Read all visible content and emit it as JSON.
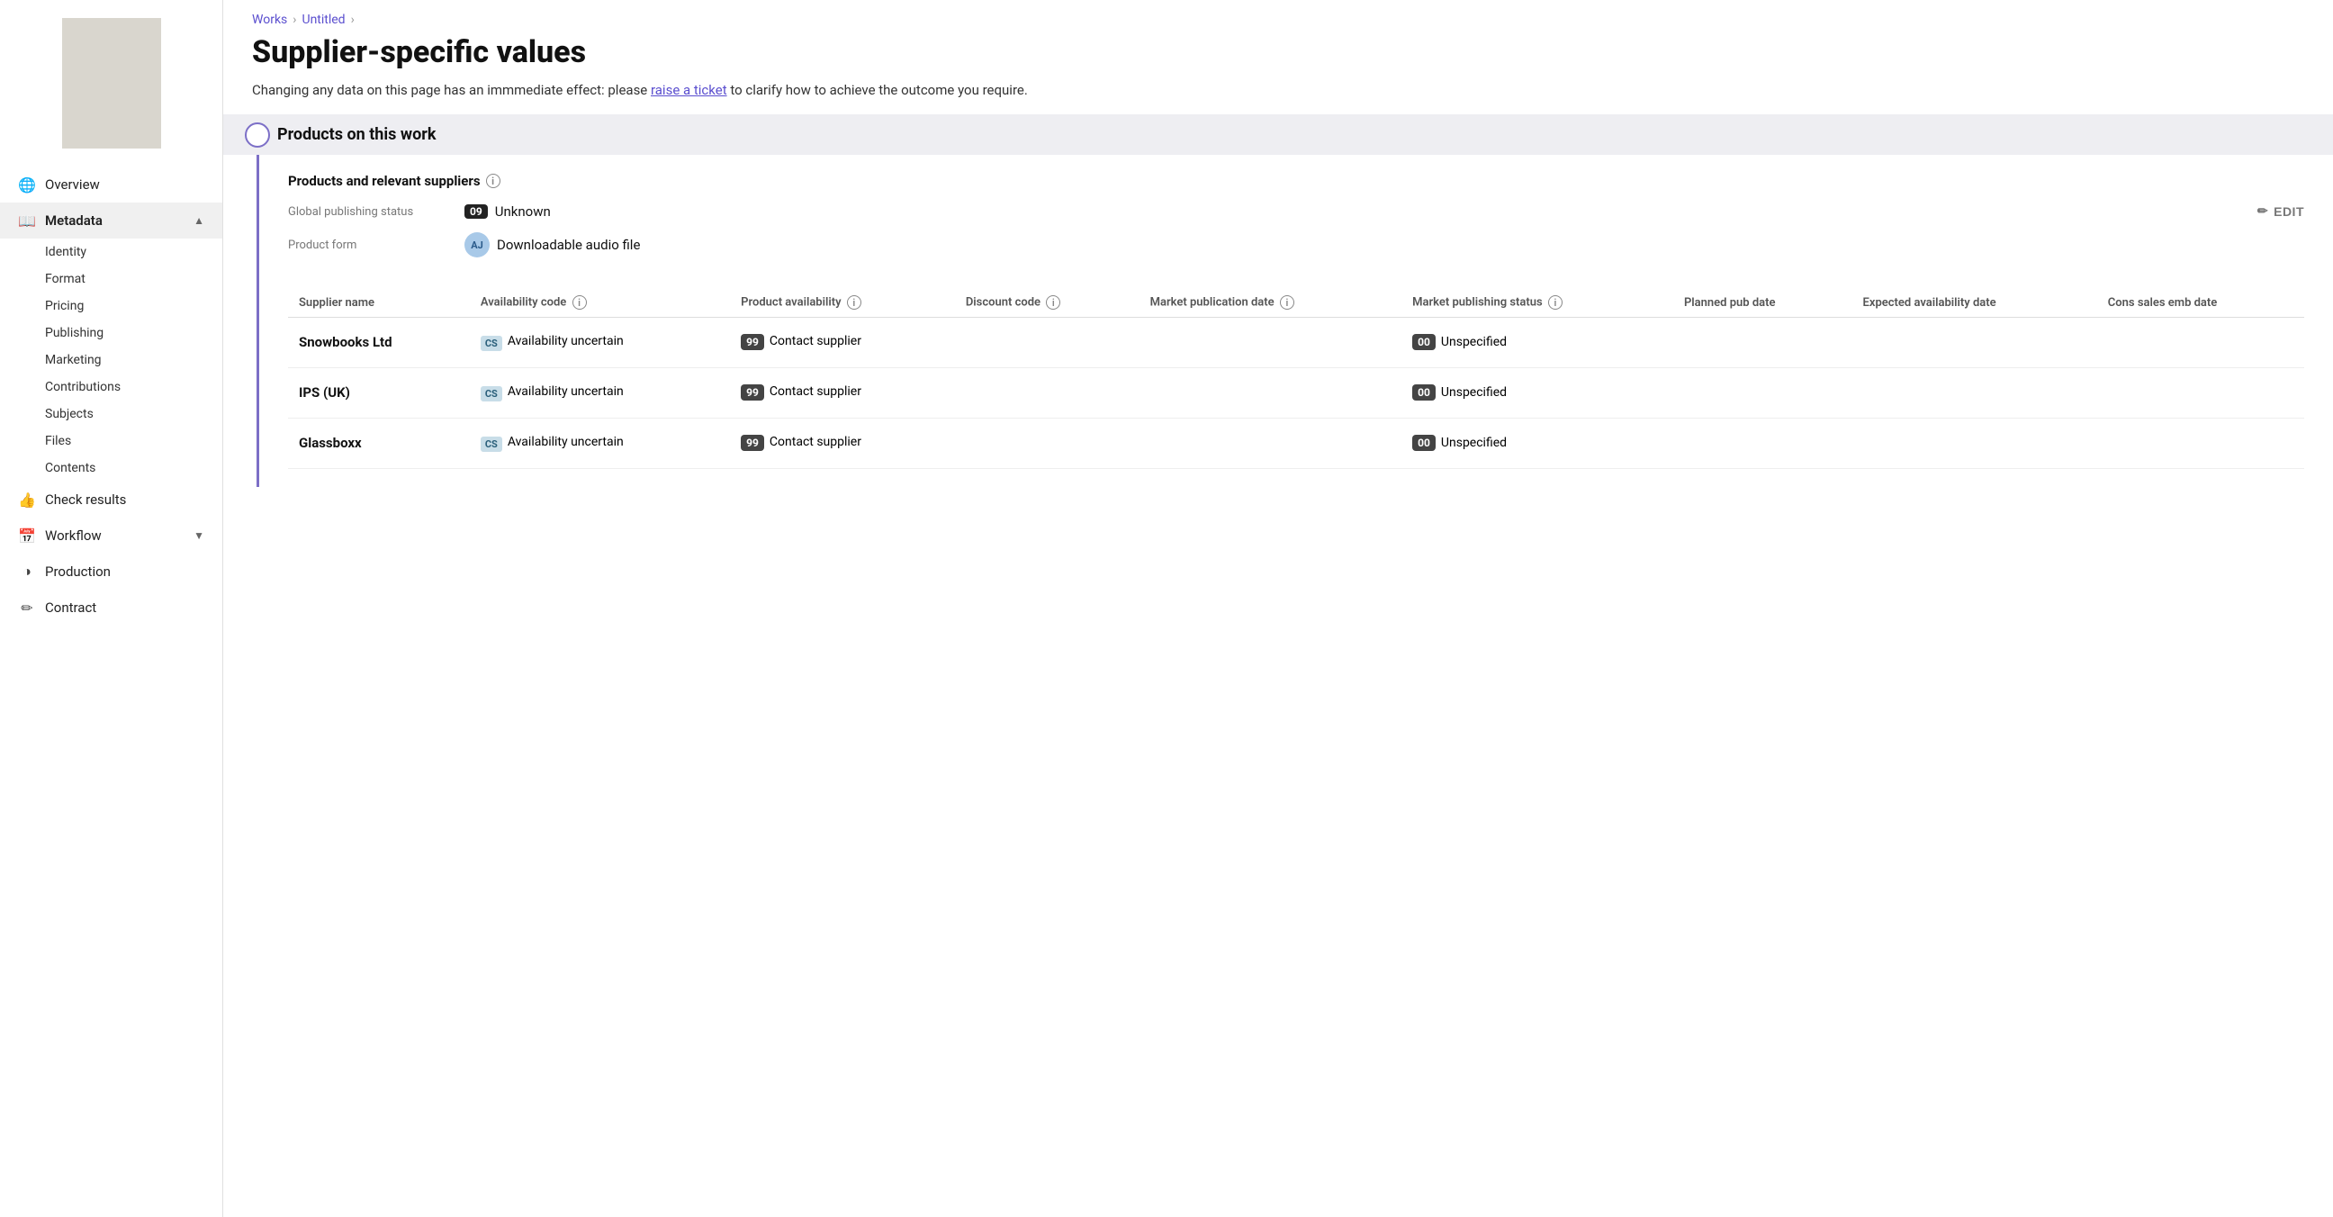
{
  "sidebar": {
    "thumbnail_alt": "Book cover thumbnail",
    "nav_items": [
      {
        "id": "overview",
        "label": "Overview",
        "icon": "🌐",
        "active": false
      },
      {
        "id": "metadata",
        "label": "Metadata",
        "icon": "📖",
        "active": true,
        "expanded": true,
        "sub_items": [
          {
            "id": "identity",
            "label": "Identity"
          },
          {
            "id": "format",
            "label": "Format"
          },
          {
            "id": "pricing",
            "label": "Pricing"
          },
          {
            "id": "publishing",
            "label": "Publishing"
          },
          {
            "id": "marketing",
            "label": "Marketing"
          },
          {
            "id": "contributions",
            "label": "Contributions"
          },
          {
            "id": "subjects",
            "label": "Subjects"
          },
          {
            "id": "files",
            "label": "Files"
          },
          {
            "id": "contents",
            "label": "Contents"
          }
        ]
      },
      {
        "id": "check-results",
        "label": "Check results",
        "icon": "👍",
        "active": false
      },
      {
        "id": "workflow",
        "label": "Workflow",
        "icon": "📅",
        "active": false,
        "has_chevron": true
      },
      {
        "id": "production",
        "label": "Production",
        "icon": "◑",
        "active": false
      },
      {
        "id": "contract",
        "label": "Contract",
        "icon": "✏",
        "active": false
      }
    ]
  },
  "breadcrumb": {
    "items": [
      "Works",
      "Untitled"
    ]
  },
  "page": {
    "title": "Supplier-specific values",
    "description_before": "Changing any data on this page has an immmediate effect: please ",
    "link_text": "raise a ticket",
    "description_after": " to clarify how to achieve the outcome you require."
  },
  "section": {
    "title": "Products on this work",
    "subsection_title": "Products and relevant suppliers",
    "global_status_label": "Global publishing status",
    "global_status_code": "09",
    "global_status_value": "Unknown",
    "product_form_label": "Product form",
    "product_form_code": "AJ",
    "product_form_value": "Downloadable audio file",
    "edit_label": "EDIT",
    "table": {
      "columns": [
        {
          "id": "supplier-name",
          "label": "Supplier name",
          "has_info": false
        },
        {
          "id": "availability-code",
          "label": "Availability code",
          "has_info": true
        },
        {
          "id": "product-availability",
          "label": "Product availability",
          "has_info": true
        },
        {
          "id": "discount-code",
          "label": "Discount code",
          "has_info": true
        },
        {
          "id": "market-publication-date",
          "label": "Market publication date",
          "has_info": true
        },
        {
          "id": "market-publishing-status",
          "label": "Market publishing status",
          "has_info": true
        },
        {
          "id": "planned-pub-date",
          "label": "Planned pub date",
          "has_info": false
        },
        {
          "id": "expected-availability-date",
          "label": "Expected availability date",
          "has_info": false
        },
        {
          "id": "cons-sales-emb-date",
          "label": "Cons sales emb date",
          "has_info": false
        }
      ],
      "rows": [
        {
          "supplier_name": "Snowbooks Ltd",
          "availability_badge": "CS",
          "availability_text": "Availability uncertain",
          "product_availability_code": "99",
          "product_availability_text": "Contact supplier",
          "discount_code": "",
          "market_pub_date": "",
          "market_publishing_code": "00",
          "market_publishing_value": "Unspecified",
          "planned_pub_date": "",
          "expected_date": "",
          "cons_date": ""
        },
        {
          "supplier_name": "IPS (UK)",
          "availability_badge": "CS",
          "availability_text": "Availability uncertain",
          "product_availability_code": "99",
          "product_availability_text": "Contact supplier",
          "discount_code": "",
          "market_pub_date": "",
          "market_publishing_code": "00",
          "market_publishing_value": "Unspecified",
          "planned_pub_date": "",
          "expected_date": "",
          "cons_date": ""
        },
        {
          "supplier_name": "Glassboxx",
          "availability_badge": "CS",
          "availability_text": "Availability uncertain",
          "product_availability_code": "99",
          "product_availability_text": "Contact supplier",
          "discount_code": "",
          "market_pub_date": "",
          "market_publishing_code": "00",
          "market_publishing_value": "Unspecified",
          "planned_pub_date": "",
          "expected_date": "",
          "cons_date": ""
        }
      ]
    }
  }
}
